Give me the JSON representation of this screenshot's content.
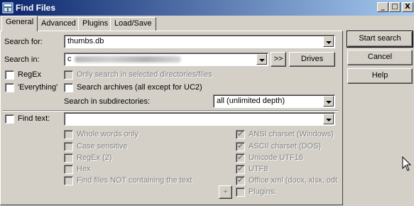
{
  "window": {
    "title": "Find Files",
    "title_bar_color": "#0a246a"
  },
  "title_buttons": {
    "minimize": "_",
    "maximize": "□",
    "close": "X"
  },
  "tabs": [
    {
      "label": "General",
      "active": true
    },
    {
      "label": "Advanced"
    },
    {
      "label": "Plugins"
    },
    {
      "label": "Load/Save"
    }
  ],
  "general": {
    "search_for_label": "Search for:",
    "search_for_value": "thumbs.db",
    "search_in_label": "Search in:",
    "search_in_value": "c",
    "arrow_button": ">>",
    "drives_button": "Drives",
    "regex_label": "RegEx",
    "only_selected_label": "Only search in selected directories/files",
    "everything_label": "'Everything'",
    "archives_label": "Search archives (all except for UC2)",
    "subdirs_label": "Search in subdirectories:",
    "subdirs_value": "all (unlimited depth)",
    "find_text_label": "Find text:",
    "find_text_value": "",
    "options_left": [
      "Whole words only",
      "Case sensitive",
      "RegEx (2)",
      "Hex",
      "Find files NOT containing the text"
    ],
    "options_right": [
      {
        "label": "ANSI charset (Windows)",
        "checked": true
      },
      {
        "label": "ASCII charset (DOS)",
        "checked": true
      },
      {
        "label": "Unicode UTF16",
        "checked": true
      },
      {
        "label": "UTF8",
        "checked": true
      },
      {
        "label": "Office xml (docx, xlsx, odt",
        "checked": true
      },
      {
        "label": "Plugins:",
        "checked": false
      }
    ],
    "plus_button": "+"
  },
  "actions": {
    "start_search": "Start search",
    "cancel": "Cancel",
    "help": "Help"
  }
}
